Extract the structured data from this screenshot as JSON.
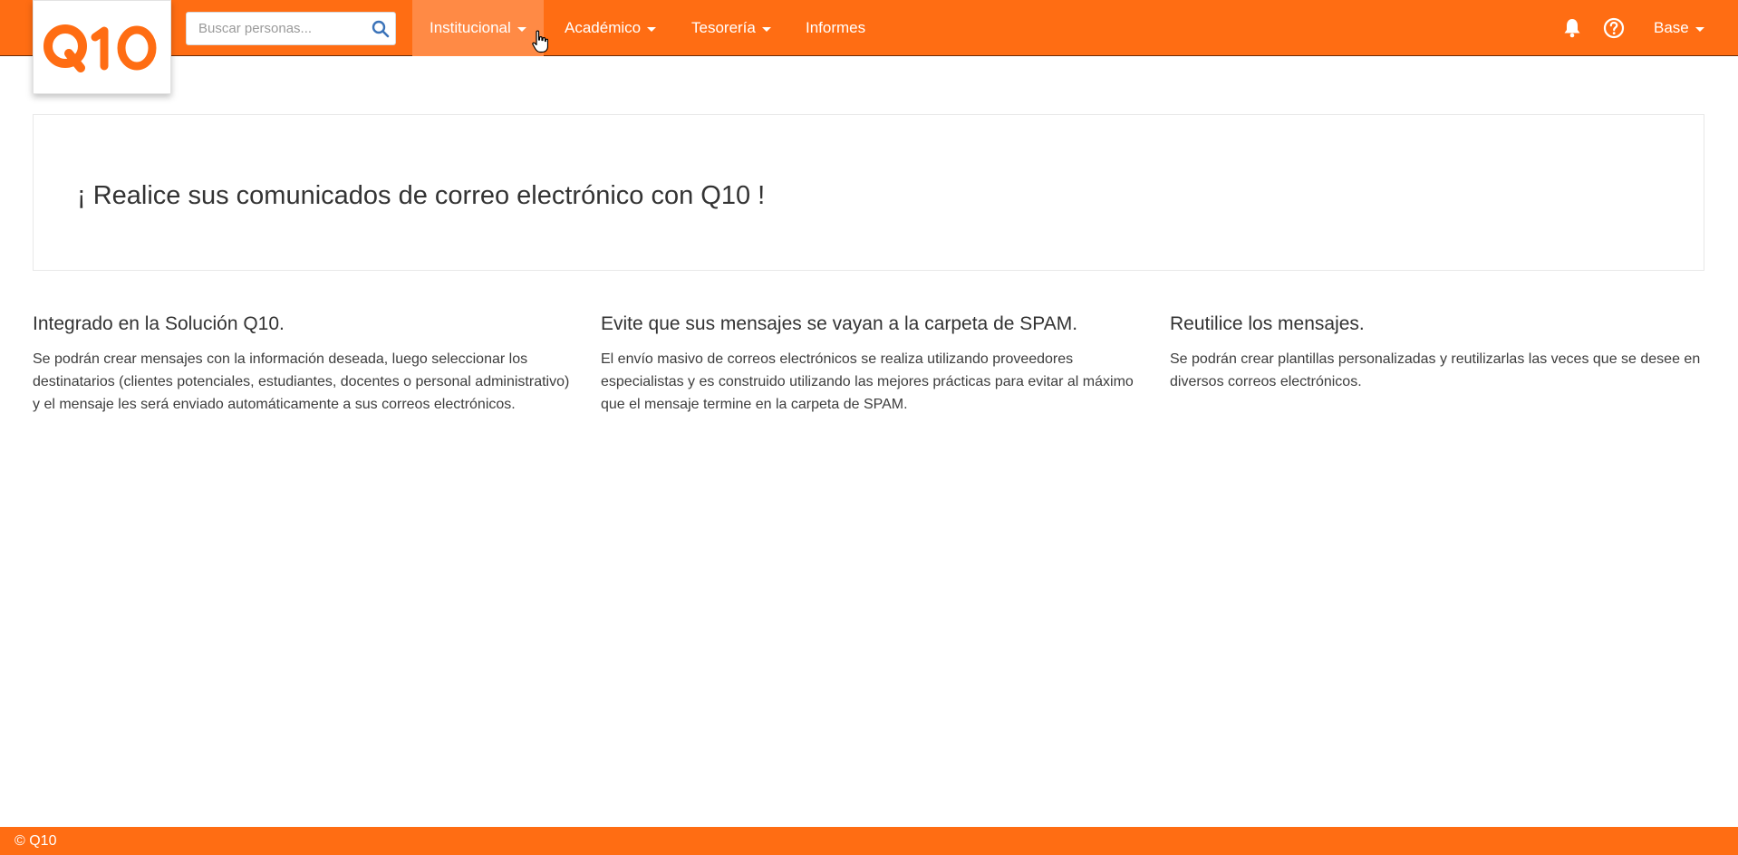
{
  "brand": {
    "logo_text": "Q10",
    "accent_color": "#ff6d13",
    "active_nav_color": "#ff8a45"
  },
  "search": {
    "placeholder": "Buscar personas...",
    "value": "",
    "icon": "search-icon"
  },
  "nav": {
    "items": [
      {
        "label": "Institucional",
        "has_dropdown": true,
        "active": true
      },
      {
        "label": "Académico",
        "has_dropdown": true,
        "active": false
      },
      {
        "label": "Tesorería",
        "has_dropdown": true,
        "active": false
      },
      {
        "label": "Informes",
        "has_dropdown": false,
        "active": false
      }
    ]
  },
  "header_right": {
    "notifications_icon": "bell-icon",
    "help_icon": "help-circle-icon",
    "user_menu_label": "Base"
  },
  "hero": {
    "title": "¡ Realice sus comunicados de correo electrónico con Q10 !"
  },
  "features": [
    {
      "title": "Integrado en la Solución Q10.",
      "text": "Se podrán crear mensajes con la información deseada, luego seleccionar los destinatarios (clientes potenciales, estudiantes, docentes o personal administrativo) y el mensaje les será enviado automáticamente a sus correos electrónicos."
    },
    {
      "title": "Evite que sus mensajes se vayan a la carpeta de SPAM.",
      "text": "El envío masivo de correos electrónicos se realiza utilizando proveedores especialistas y es construido utilizando las mejores prácticas para evitar al máximo que el mensaje termine en la carpeta de SPAM."
    },
    {
      "title": "Reutilice los mensajes.",
      "text": "Se podrán crear plantillas personalizadas y reutilizarlas las veces que se desee en diversos correos electrónicos."
    }
  ],
  "footer": {
    "text": "© Q10"
  }
}
